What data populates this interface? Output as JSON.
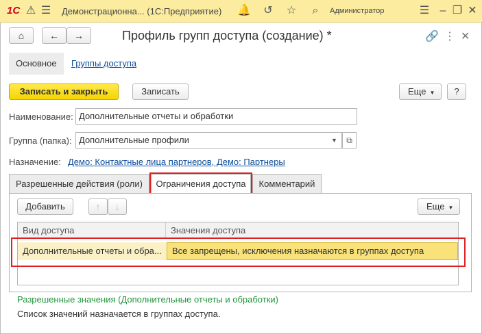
{
  "titlebar": {
    "logo": "1С",
    "app_title": "Демонстрационна...  (1С:Предприятие)",
    "user": "Администратор"
  },
  "toolbar": {
    "title": "Профиль групп доступа (создание) *",
    "save_close": "Записать и закрыть",
    "save": "Записать",
    "more": "Еще",
    "help": "?"
  },
  "nav": {
    "main": "Основное",
    "groups": "Группы доступа"
  },
  "form": {
    "name_label": "Наименование:",
    "name_value": "Дополнительные отчеты и обработки",
    "group_label": "Группа (папка):",
    "group_value": "Дополнительные профили",
    "purpose_label": "Назначение:",
    "purpose_value": "Демо: Контактные лица партнеров, Демо: Партнеры"
  },
  "tabs": [
    {
      "label": "Разрешенные действия (роли)"
    },
    {
      "label": "Ограничения доступа"
    },
    {
      "label": "Комментарий"
    }
  ],
  "panel": {
    "add": "Добавить",
    "more": "Еще",
    "columns": [
      "Вид доступа",
      "Значения доступа"
    ],
    "rows": [
      {
        "kind": "Дополнительные отчеты и обра...",
        "values": "Все запрещены, исключения назначаются в группах доступа"
      }
    ],
    "allowed_title": "Разрешенные значения (Дополнительные отчеты и обработки)",
    "allowed_note": "Список значений назначается в группах доступа."
  }
}
